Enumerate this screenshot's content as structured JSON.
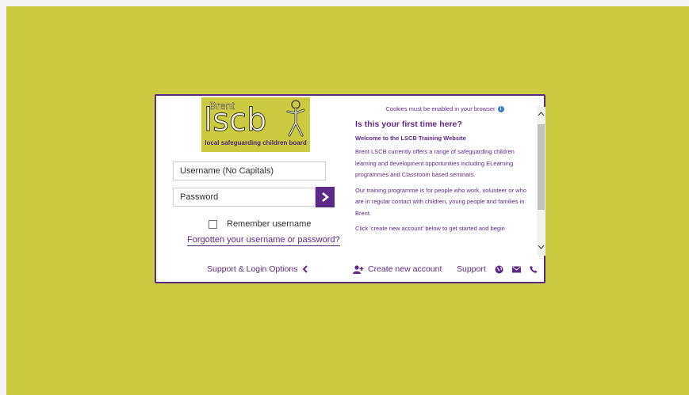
{
  "logo": {
    "word_brent": "Brent",
    "word_lscb": "lscb",
    "tagline": "local safeguarding children board"
  },
  "login": {
    "username_placeholder": "Username (No Capitals)",
    "password_placeholder": "Password",
    "remember_label": "Remember username",
    "remember_checked": false,
    "forgot_link": "Forgotten your username or password?"
  },
  "info": {
    "cookies_note": "Cookies must be enabled in your browser",
    "first_time_heading": "Is this your first time here?",
    "welcome_heading": "Welcome to the LSCB Training Website",
    "paragraphs": [
      "Brent LSCB currently offers a range of safeguarding children learning and development opportunities including ELearning programmes and Classroom based seminars.",
      "Our training programme is for people who work, volunteer or who are in regular contact with children, young people and families in Brent.",
      "Click 'create new account' below to get started and begin"
    ]
  },
  "footer": {
    "support_options_label": "Support & Login Options",
    "create_account_label": "Create new account",
    "support_label": "Support"
  },
  "colors": {
    "background": "#cbcb42",
    "accent": "#5b2a86",
    "info_icon": "#3d7fc4"
  },
  "icons": [
    "info-icon",
    "chevron-right-icon",
    "chevron-left-icon",
    "add-user-icon",
    "globe-icon",
    "envelope-icon",
    "phone-icon",
    "chevron-up-icon",
    "chevron-down-icon"
  ]
}
